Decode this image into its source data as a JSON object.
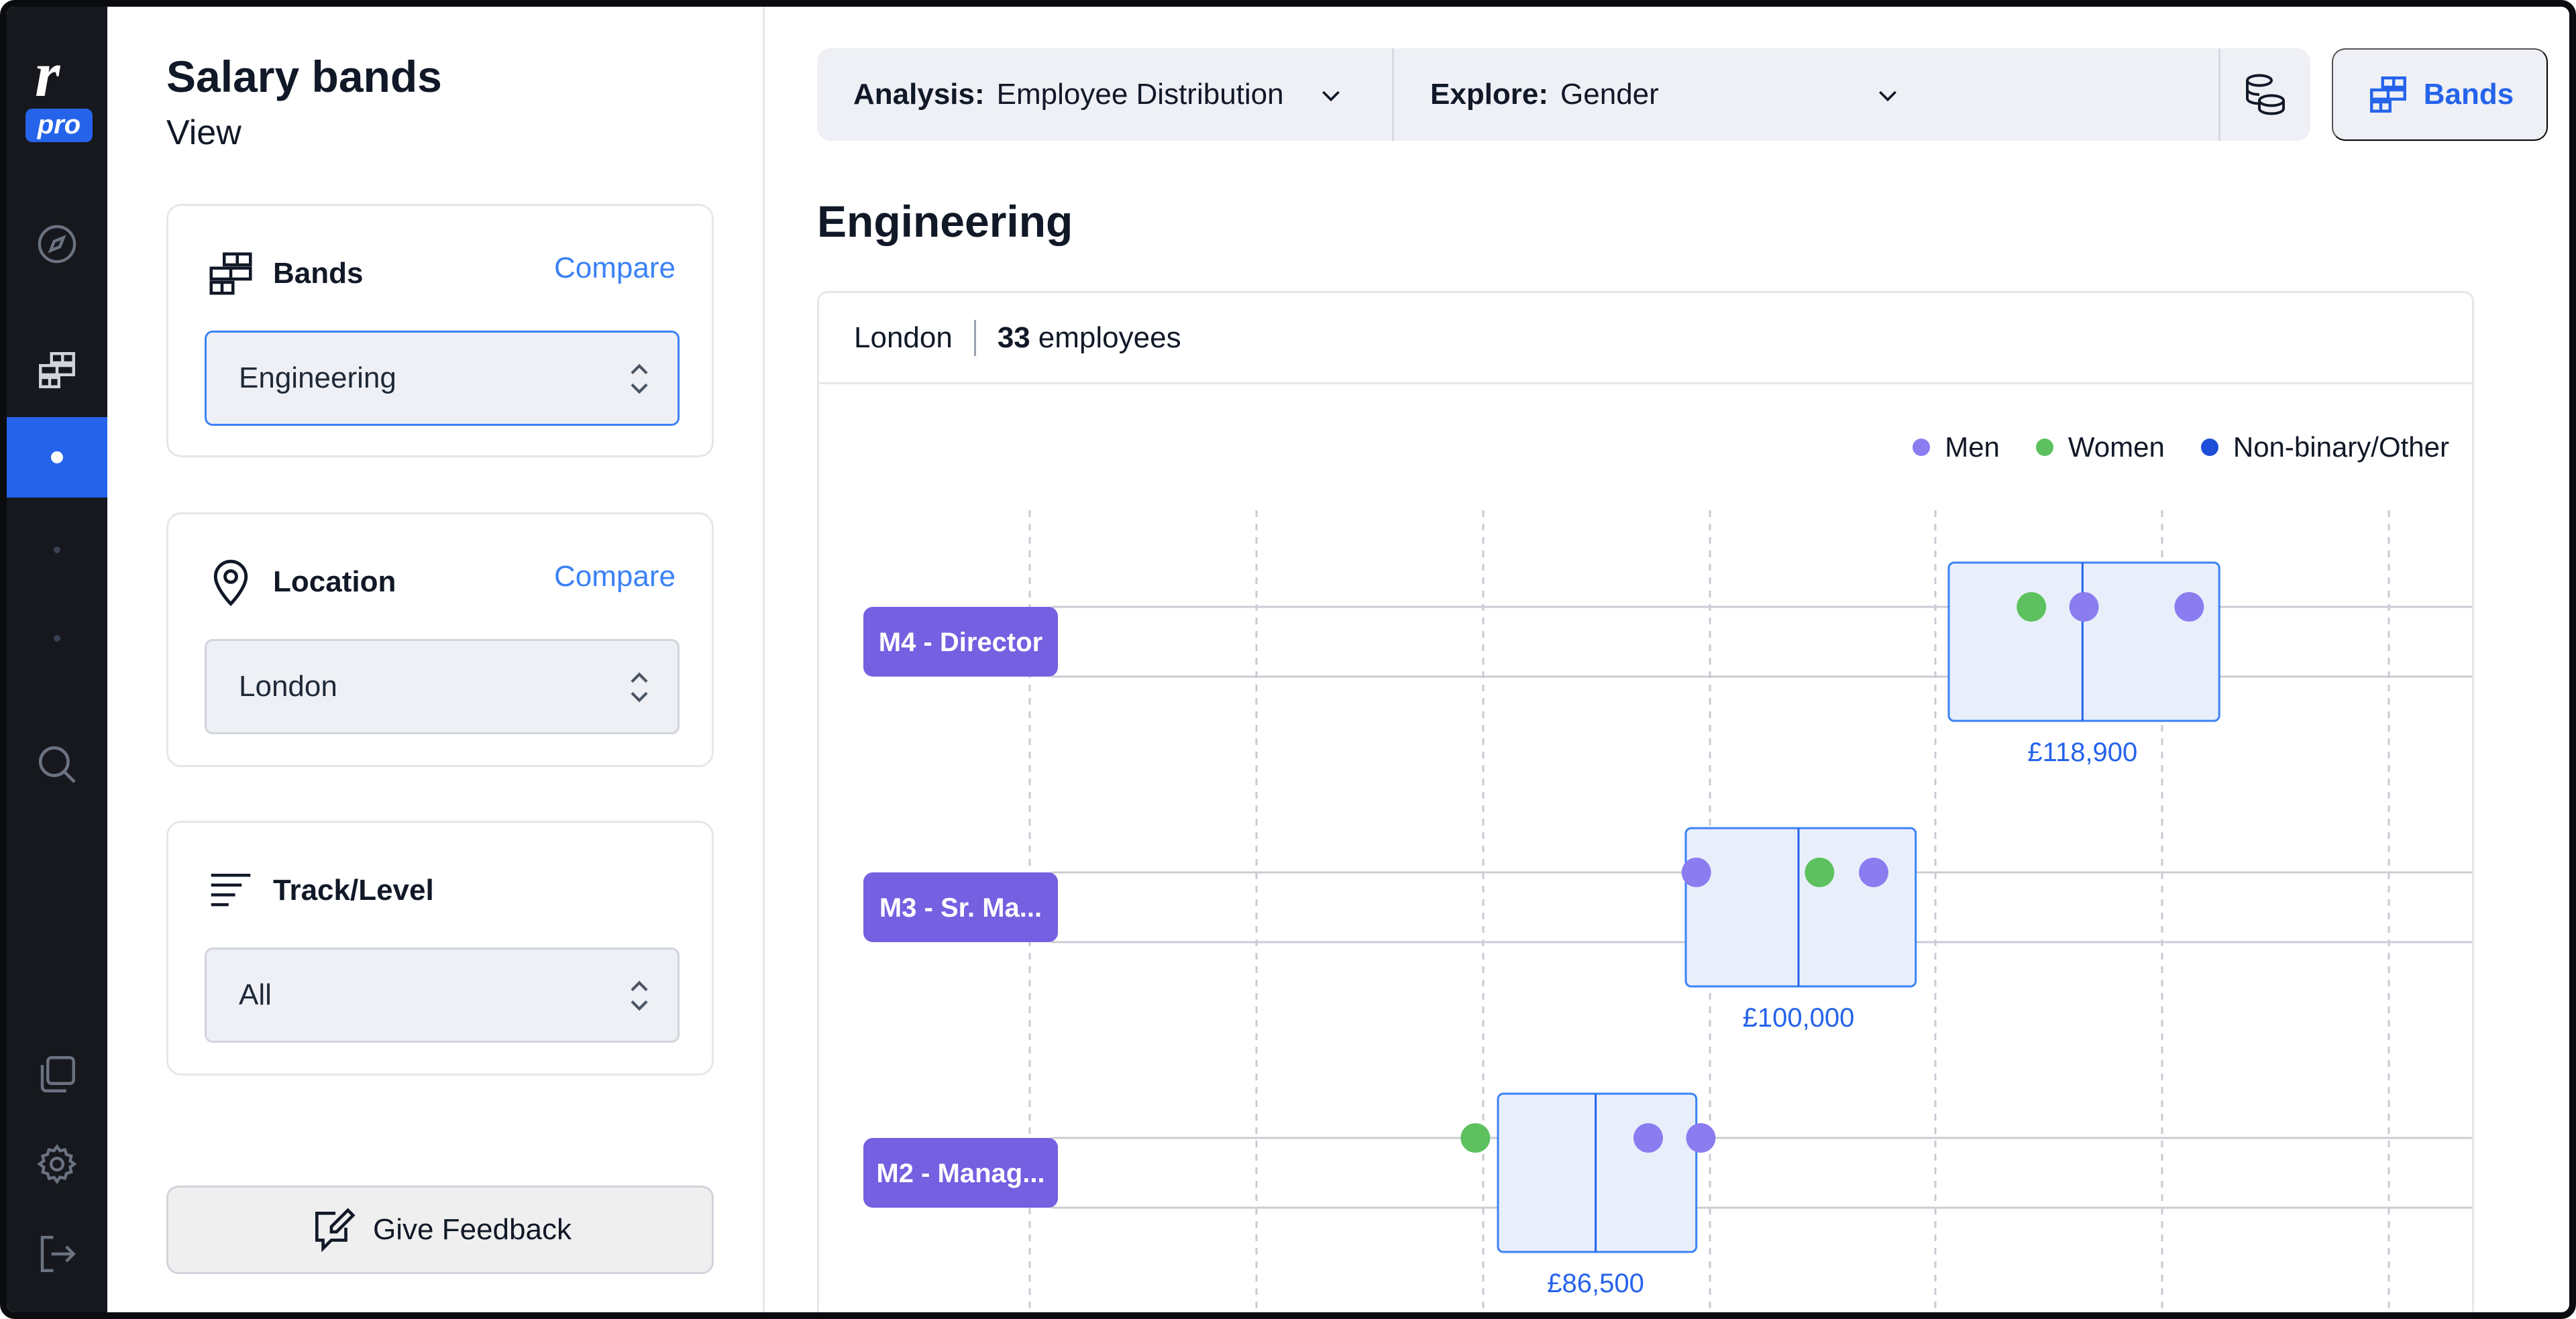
{
  "app": {
    "logo_mark": "r",
    "logo_badge": "pro"
  },
  "rail": {
    "items": [
      {
        "name": "explore",
        "icon": "compass-icon"
      },
      {
        "name": "bands",
        "icon": "bands-icon"
      },
      {
        "name": "current",
        "icon": "dot-icon"
      },
      {
        "name": "search",
        "icon": "search-icon"
      },
      {
        "name": "copy",
        "icon": "copy-icon"
      },
      {
        "name": "settings",
        "icon": "gear-icon"
      },
      {
        "name": "logout",
        "icon": "logout-icon"
      }
    ]
  },
  "panel": {
    "title": "Salary bands",
    "subtitle": "View",
    "bands": {
      "label": "Bands",
      "compare": "Compare",
      "value": "Engineering",
      "icon": "bands-icon"
    },
    "location": {
      "label": "Location",
      "compare": "Compare",
      "value": "London",
      "icon": "pin-icon"
    },
    "track": {
      "label": "Track/Level",
      "value": "All",
      "icon": "lines-icon"
    },
    "feedback": {
      "label": "Give Feedback",
      "icon": "edit-icon"
    }
  },
  "toolbar": {
    "analysis_label": "Analysis:",
    "analysis_value": "Employee Distribution",
    "explore_label": "Explore:",
    "explore_value": "Gender",
    "bands_button": "Bands",
    "colors": {
      "accent": "#2563eb"
    }
  },
  "main": {
    "title": "Engineering",
    "location": "London",
    "employee_count": "33",
    "employee_suffix": "employees"
  },
  "chart_data": {
    "type": "scatter",
    "legend": [
      {
        "name": "Men",
        "color": "#8b7cf0"
      },
      {
        "name": "Women",
        "color": "#5cc15e"
      },
      {
        "name": "Non-binary/Other",
        "color": "#1d4ed8"
      }
    ],
    "legend_position": "top-right",
    "grid": true,
    "rows": [
      {
        "level": "M4 - Director",
        "band_min": 110000,
        "band_max": 128000,
        "midpoint": 118900,
        "midpoint_label": "£118,900",
        "points": [
          {
            "series": "Women",
            "value": 115500
          },
          {
            "series": "Men",
            "value": 119000
          },
          {
            "series": "Men",
            "value": 126000
          }
        ]
      },
      {
        "level": "M3 - Sr. Ma...",
        "band_min": 92500,
        "band_max": 107800,
        "midpoint": 100000,
        "midpoint_label": "£100,000",
        "points": [
          {
            "series": "Men",
            "value": 93200
          },
          {
            "series": "Women",
            "value": 101400
          },
          {
            "series": "Men",
            "value": 105000
          }
        ]
      },
      {
        "level": "M2 - Manag...",
        "band_min": 80000,
        "band_max": 93200,
        "midpoint": 86500,
        "midpoint_label": "£86,500",
        "points": [
          {
            "series": "Women",
            "value": 78500
          },
          {
            "series": "Men",
            "value": 90000
          },
          {
            "series": "Men",
            "value": 93500
          }
        ]
      }
    ]
  }
}
